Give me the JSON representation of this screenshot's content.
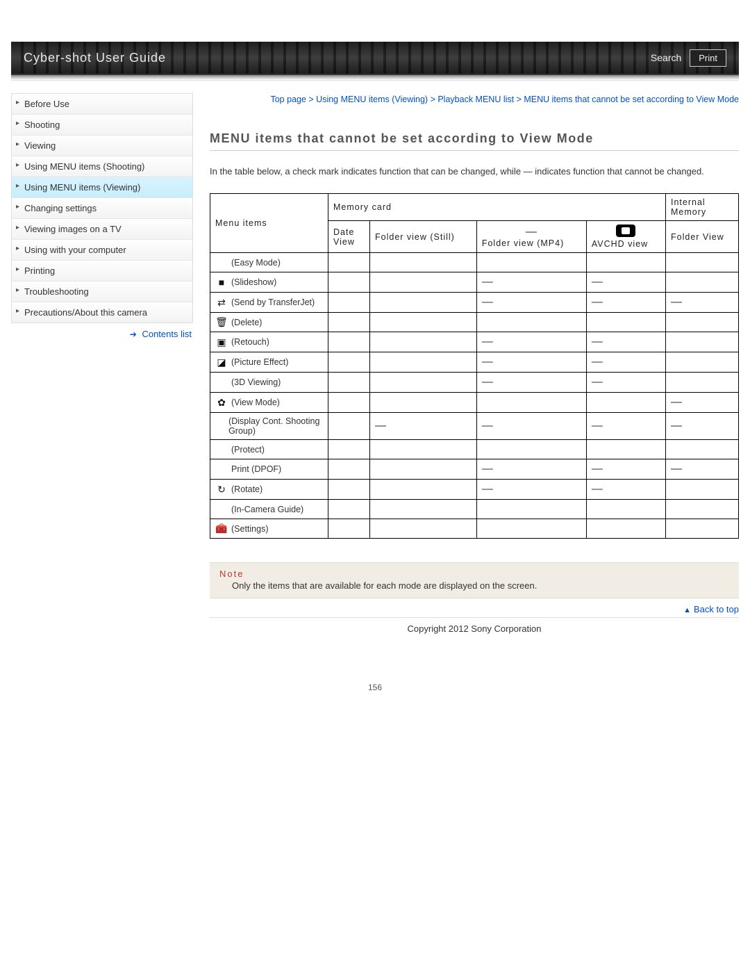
{
  "header": {
    "title": "Cyber-shot User Guide",
    "search_label": "Search",
    "print_label": "Print"
  },
  "sidebar": {
    "items": [
      {
        "label": "Before Use"
      },
      {
        "label": "Shooting"
      },
      {
        "label": "Viewing"
      },
      {
        "label": "Using MENU items (Shooting)"
      },
      {
        "label": "Using MENU items (Viewing)",
        "active": true
      },
      {
        "label": "Changing settings"
      },
      {
        "label": "Viewing images on a TV"
      },
      {
        "label": "Using with your computer"
      },
      {
        "label": "Printing"
      },
      {
        "label": "Troubleshooting"
      },
      {
        "label": "Precautions/About this camera"
      }
    ],
    "contents_list_label": "Contents list"
  },
  "breadcrumb": {
    "parts": [
      "Top page",
      "Using MENU items (Viewing)",
      "Playback MENU list",
      "MENU items that cannot be set according to View Mode"
    ],
    "sep": " > "
  },
  "page_title": "MENU items that cannot be set according to View Mode",
  "intro": "In the table below, a check mark indicates function that can be changed, while — indicates function that cannot be changed.",
  "table": {
    "header": {
      "menu_items": "Menu items",
      "memory_card": "Memory card",
      "internal_memory": "Internal Memory",
      "cols": {
        "date_view": "Date View",
        "folder_still": "Folder view (Still)",
        "folder_mp4": "Folder view (MP4)",
        "avchd": "AVCHD view",
        "folder_view_int": "Folder View"
      },
      "mp4_icon_label": "—"
    },
    "rows": [
      {
        "label": "(Easy Mode)",
        "icon": "",
        "cells": [
          "",
          "",
          "",
          "",
          ""
        ]
      },
      {
        "label": "(Slideshow)",
        "icon": "■",
        "cells": [
          "",
          "",
          "—",
          "—",
          ""
        ]
      },
      {
        "label": "(Send by TransferJet)",
        "icon": "⇄",
        "cells": [
          "",
          "",
          "—",
          "—",
          "—"
        ]
      },
      {
        "label": "(Delete)",
        "icon": "🗑",
        "cells": [
          "",
          "",
          "",
          "",
          ""
        ]
      },
      {
        "label": "(Retouch)",
        "icon": "▣",
        "cells": [
          "",
          "",
          "—",
          "—",
          ""
        ]
      },
      {
        "label": "(Picture Effect)",
        "icon": "◪",
        "cells": [
          "",
          "",
          "—",
          "—",
          ""
        ]
      },
      {
        "label": "(3D Viewing)",
        "icon": "",
        "cells": [
          "",
          "",
          "—",
          "—",
          ""
        ]
      },
      {
        "label": "(View Mode)",
        "icon": "✿",
        "cells": [
          "",
          "",
          "",
          "",
          "—"
        ]
      },
      {
        "label": "(Display Cont. Shooting Group)",
        "icon": "",
        "cells": [
          "",
          "—",
          "—",
          "—",
          "—"
        ]
      },
      {
        "label": "(Protect)",
        "icon": "",
        "cells": [
          "",
          "",
          "",
          "",
          ""
        ]
      },
      {
        "label": "Print (DPOF)",
        "icon": "",
        "cells": [
          "",
          "",
          "—",
          "—",
          "—"
        ]
      },
      {
        "label": "(Rotate)",
        "icon": "↻",
        "cells": [
          "",
          "",
          "—",
          "—",
          ""
        ]
      },
      {
        "label": "(In-Camera Guide)",
        "icon": "",
        "cells": [
          "",
          "",
          "",
          "",
          ""
        ]
      },
      {
        "label": "(Settings)",
        "icon": "🧰",
        "cells": [
          "",
          "",
          "",
          "",
          ""
        ]
      }
    ]
  },
  "note": {
    "title": "Note",
    "body": "Only the items that are available for each mode are displayed on the screen."
  },
  "back_to_top": "Back to top",
  "copyright": "Copyright 2012 Sony Corporation",
  "page_number": "156"
}
